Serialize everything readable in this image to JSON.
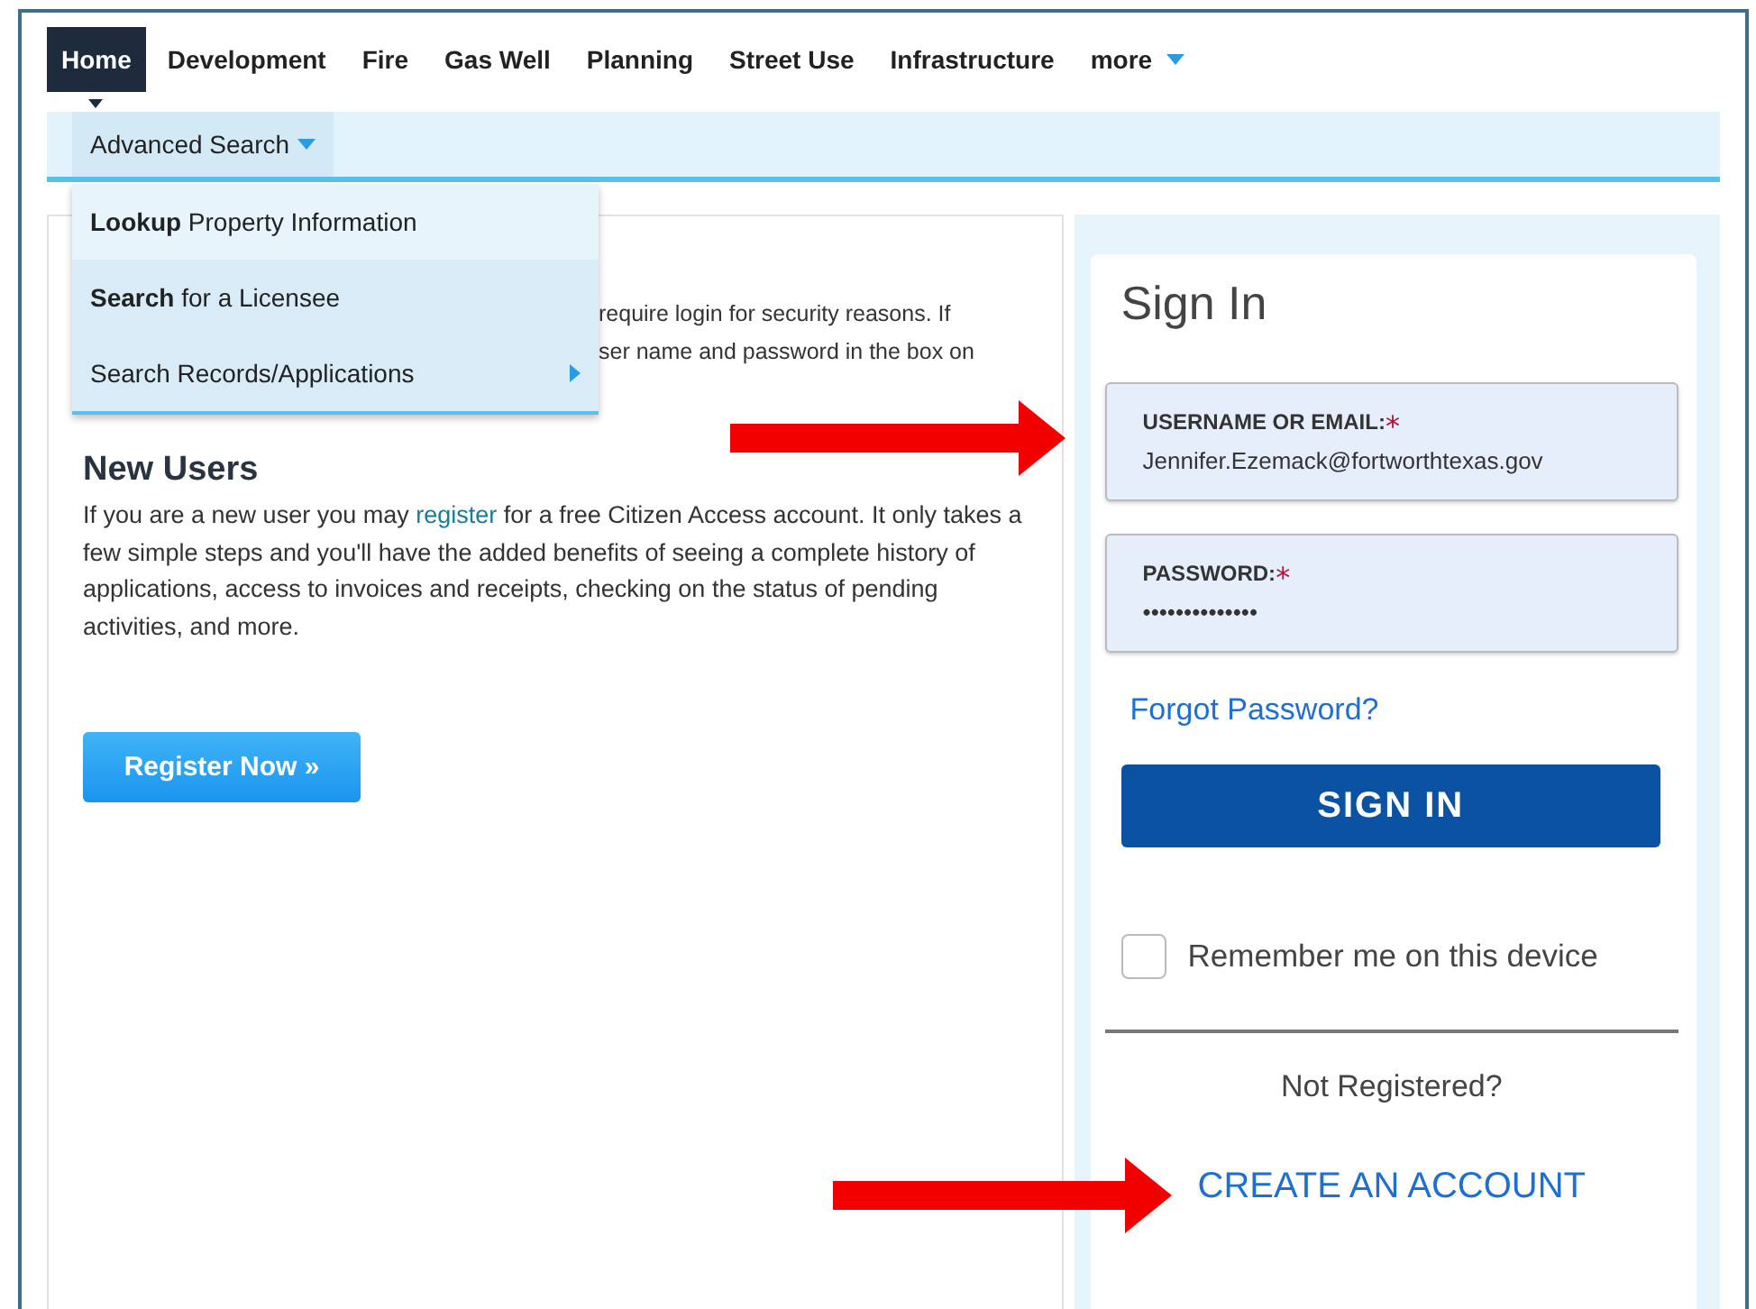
{
  "nav": {
    "tabs": [
      {
        "label": "Home",
        "selected": true,
        "caret": false
      },
      {
        "label": "Development",
        "selected": false,
        "caret": false
      },
      {
        "label": "Fire",
        "selected": false,
        "caret": false
      },
      {
        "label": "Gas Well",
        "selected": false,
        "caret": false
      },
      {
        "label": "Planning",
        "selected": false,
        "caret": false
      },
      {
        "label": "Street Use",
        "selected": false,
        "caret": false
      },
      {
        "label": "Infrastructure",
        "selected": false,
        "caret": false
      },
      {
        "label": "more",
        "selected": false,
        "caret": true
      }
    ]
  },
  "subnav": {
    "label": "Advanced Search",
    "expanded": true
  },
  "menu": {
    "items": [
      {
        "label": "**Lookup** Property Information",
        "submenu": false,
        "selected": true
      },
      {
        "label": "**Search** for a Licensee",
        "submenu": false,
        "selected": false
      },
      {
        "label": "Search Records/Applications",
        "submenu": true,
        "selected": false
      }
    ]
  },
  "intro": {
    "lines": [
      "require login for security reasons. If",
      "ser name and password in the box on"
    ]
  },
  "new_users": {
    "heading": "New Users",
    "text_before": "If you are a new user you may",
    "link": "register",
    "text_after": "for a free Citizen Access account. It only takes a few simple steps and you'll have the added benefits of seeing a complete history of applications, access to invoices and receipts, checking on the status of pending activities, and more.",
    "button": "Register Now »"
  },
  "sign_in": {
    "title": "Sign In",
    "fields": [
      {
        "label": "USERNAME OR EMAIL:",
        "required_mark": "*",
        "value": "Jennifer.Ezemack@fortworthtexas.gov"
      },
      {
        "label": "PASSWORD:",
        "required_mark": "*",
        "value": "••••••••••••••"
      }
    ],
    "forgot": "Forgot Password?",
    "button": "SIGN IN",
    "remember": {
      "label": "Remember me on this device",
      "checked": false
    },
    "not_registered": "Not Registered?",
    "create": "CREATE AN ACCOUNT"
  },
  "annotations": [
    {
      "kind": "arrow"
    },
    {
      "kind": "arrow"
    }
  ]
}
